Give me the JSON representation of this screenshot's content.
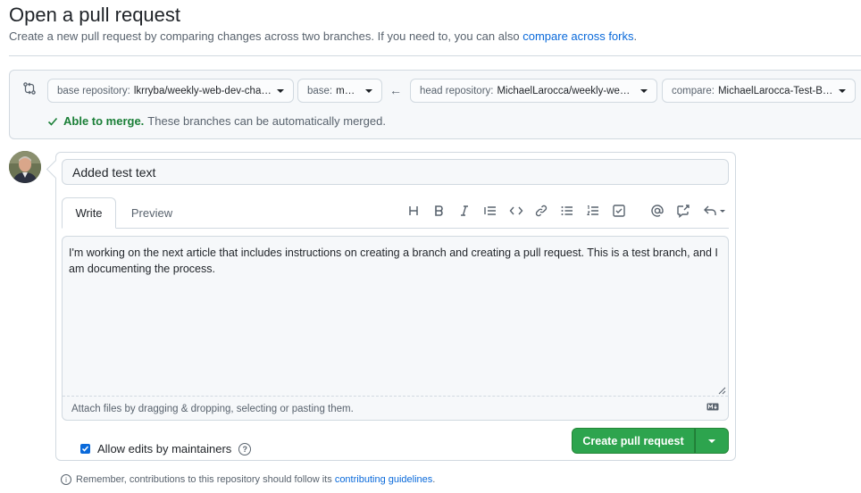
{
  "header": {
    "title": "Open a pull request",
    "subtitle": "Create a new pull request by comparing changes across two branches. If you need to, you can also",
    "subtitle_link": "compare across forks",
    "subtitle_end": "."
  },
  "range": {
    "base_repo_label": "base repository:",
    "base_repo_value": "lkrryba/weekly-web-dev-challe...",
    "base_label": "base:",
    "base_value": "master",
    "arrow": "←",
    "head_repo_label": "head repository:",
    "head_repo_value": "MichaelLarocca/weekly-web-d...",
    "compare_label": "compare:",
    "compare_value": "MichaelLarocca-Test-Branch",
    "merge_status": "Able to merge.",
    "merge_message": "These branches can be automatically merged."
  },
  "form": {
    "title_value": "Added test text",
    "tabs": [
      {
        "label": "Write"
      },
      {
        "label": "Preview"
      }
    ],
    "toolbar_icons": [
      "heading-icon",
      "bold-icon",
      "italic-icon",
      "quote-icon",
      "code-icon",
      "link-icon",
      "unordered-list-icon",
      "ordered-list-icon",
      "task-list-icon",
      "mention-icon",
      "reference-icon",
      "reply-icon"
    ],
    "body_text": "I'm working on the next article that includes instructions on creating a branch and creating a pull request. This is a test branch, and I am documenting the process.",
    "attach_text": "Attach files by dragging & dropping, selecting or pasting them.",
    "allow_edits_label": "Allow edits by maintainers",
    "allow_edits_checked": true,
    "create_button": "Create pull request"
  },
  "footer": {
    "note": "Remember, contributions to this repository should follow its",
    "note_link": "contributing guidelines",
    "note_end": "."
  },
  "colors": {
    "accent": "#0969da",
    "success": "#1a7f37",
    "button": "#2da44e"
  }
}
